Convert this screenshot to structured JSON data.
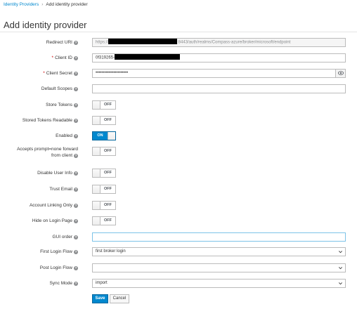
{
  "breadcrumb": {
    "parent": "Identity Providers",
    "current": "Add identity provider"
  },
  "page_title": "Add identity provider",
  "fields": {
    "redirect_uri": {
      "label": "Redirect URI",
      "value_prefix": "https://",
      "value_suffix": ":8443/auth/realms/Compass-azure/broker/microsoft/endpoint"
    },
    "client_id": {
      "label": "Client ID",
      "value_prefix": "0f319265-"
    },
    "client_secret": {
      "label": "Client Secret",
      "value": "••••••••••••••••••••••"
    },
    "default_scopes": {
      "label": "Default Scopes",
      "value": ""
    },
    "store_tokens": {
      "label": "Store Tokens",
      "state": "OFF"
    },
    "stored_tokens_readable": {
      "label": "Stored Tokens Readable",
      "state": "OFF"
    },
    "enabled": {
      "label": "Enabled",
      "state": "ON"
    },
    "accepts_prompt": {
      "label_line1": "Accepts prompt=none forward",
      "label_line2": "from client",
      "state": "OFF"
    },
    "disable_user_info": {
      "label": "Disable User Info",
      "state": "OFF"
    },
    "trust_email": {
      "label": "Trust Email",
      "state": "OFF"
    },
    "account_linking_only": {
      "label": "Account Linking Only",
      "state": "OFF"
    },
    "hide_on_login_page": {
      "label": "Hide on Login Page",
      "state": "OFF"
    },
    "gui_order": {
      "label": "GUI order",
      "value": ""
    },
    "first_login_flow": {
      "label": "First Login Flow",
      "value": "first broker login"
    },
    "post_login_flow": {
      "label": "Post Login Flow",
      "value": ""
    },
    "sync_mode": {
      "label": "Sync Mode",
      "value": "import"
    }
  },
  "buttons": {
    "save": "Save",
    "cancel": "Cancel"
  },
  "help_glyph": "?",
  "required_mark": "*",
  "icons": {
    "help": "question-circle-icon",
    "eye": "eye-icon",
    "dropdown": "chevron-down-icon"
  },
  "colors": {
    "link": "#0088ce",
    "primary": "#0088ce",
    "required": "#cc0000",
    "border": "#bbbbbb"
  }
}
